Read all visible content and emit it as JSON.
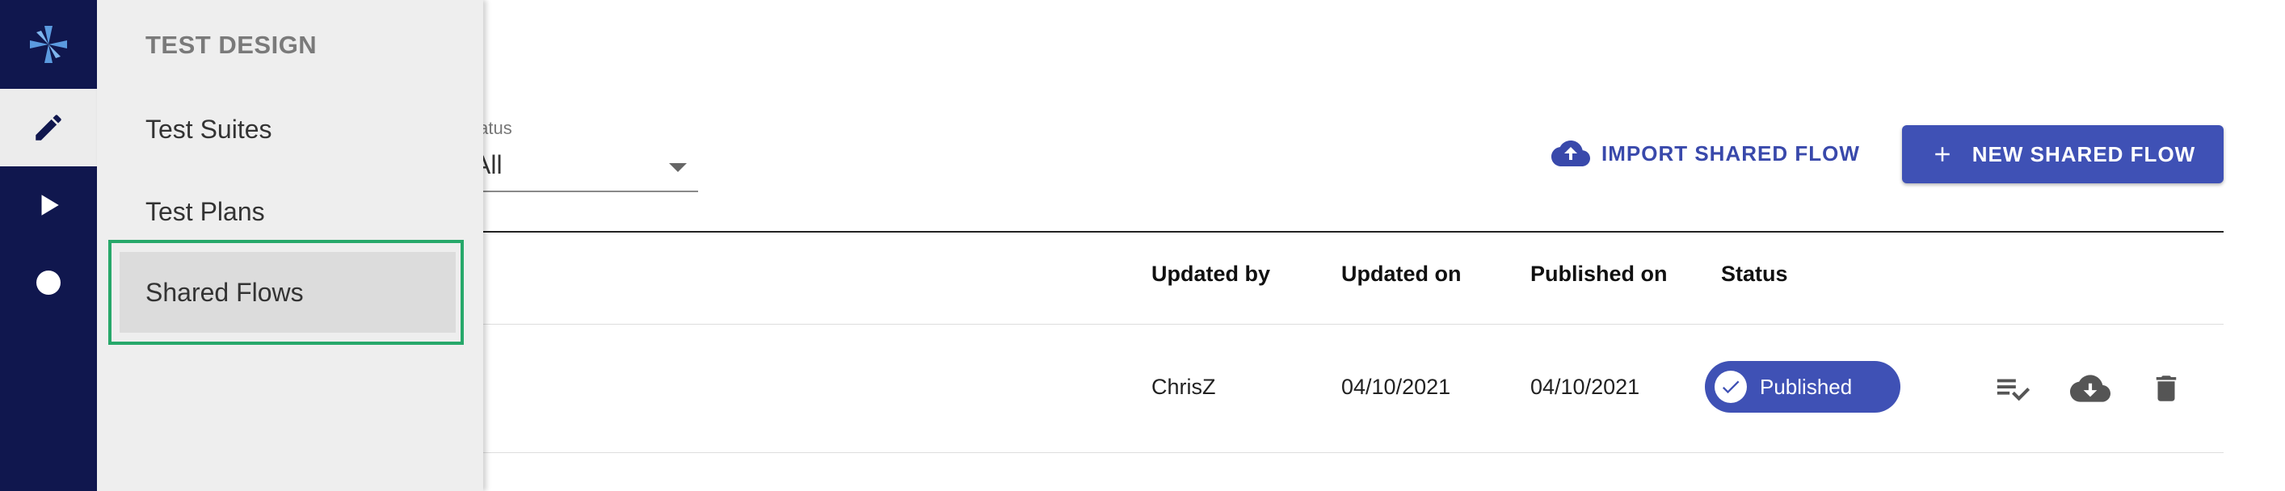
{
  "nav_rail": {
    "items": [
      {
        "icon": "edit-icon",
        "active": true
      },
      {
        "icon": "play-icon",
        "active": false
      },
      {
        "icon": "circle-icon",
        "active": false
      }
    ]
  },
  "drawer": {
    "heading": "TEST DESIGN",
    "items": [
      "Test Suites",
      "Test Plans",
      "Shared Flows"
    ],
    "selected": "Shared Flows"
  },
  "filters": {
    "status_label": "tatus",
    "status_value": "All"
  },
  "toolbar": {
    "import_label": "IMPORT SHARED FLOW",
    "new_label": "NEW SHARED FLOW"
  },
  "table": {
    "headers": {
      "updated_by": "Updated by",
      "updated_on": "Updated on",
      "published_on": "Published on",
      "status": "Status"
    },
    "rows": [
      {
        "updated_by": "ChrisZ",
        "updated_on": "04/10/2021",
        "published_on": "04/10/2021",
        "status": "Published"
      }
    ]
  },
  "colors": {
    "rail": "#10174e",
    "primary": "#3f51b5",
    "selection_outline": "#27a86a",
    "drawer_bg": "#eeeeee"
  }
}
